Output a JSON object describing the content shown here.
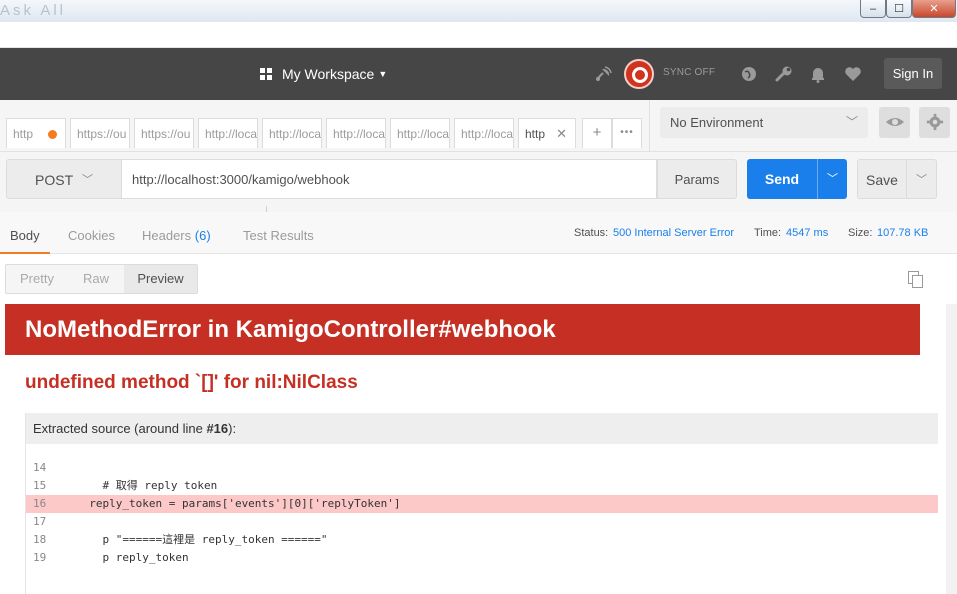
{
  "window": {
    "title_fragment": "Ask All",
    "controls": {
      "minimize": "‒",
      "maximize": "☐",
      "close": "✕"
    }
  },
  "header": {
    "workspace_label": "My Workspace",
    "sync_label": "SYNC OFF",
    "signin_label": "Sign In",
    "icons": [
      "satellite-icon",
      "sync-icon",
      "globe-icon",
      "wrench-icon",
      "bell-icon",
      "heart-icon"
    ]
  },
  "tabs": [
    {
      "label": "http",
      "has_dot": true
    },
    {
      "label": "https://ou"
    },
    {
      "label": "https://ou"
    },
    {
      "label": "http://loca"
    },
    {
      "label": "http://loca"
    },
    {
      "label": "http://loca"
    },
    {
      "label": "http://loca"
    },
    {
      "label": "http://loca"
    },
    {
      "label": "http",
      "active": true,
      "closable": true
    }
  ],
  "tab_actions": {
    "add": "+",
    "more": "•••"
  },
  "environment": {
    "selected": "No Environment"
  },
  "request": {
    "method": "POST",
    "url": "http://localhost:3000/kamigo/webhook",
    "params_label": "Params",
    "send_label": "Send",
    "save_label": "Save"
  },
  "response": {
    "tabs": {
      "body": "Body",
      "cookies": "Cookies",
      "headers": "Headers",
      "headers_count": "(6)",
      "tests": "Test Results"
    },
    "status_label": "Status:",
    "status_value": "500 Internal Server Error",
    "time_label": "Time:",
    "time_value": "4547 ms",
    "size_label": "Size:",
    "size_value": "107.78 KB",
    "views": {
      "pretty": "Pretty",
      "raw": "Raw",
      "preview": "Preview"
    }
  },
  "preview": {
    "error_title": "NoMethodError in KamigoController#webhook",
    "error_message": "undefined method `[]' for nil:NilClass",
    "source_header_prefix": "Extracted source (around line ",
    "source_header_line": "#16",
    "source_header_suffix": "):",
    "source_lines": [
      {
        "num": "14",
        "code": ""
      },
      {
        "num": "15",
        "code": "    # 取得 reply token"
      },
      {
        "num": "16",
        "code": "  reply_token = params['events'][0]['replyToken']",
        "highlight": true
      },
      {
        "num": "17",
        "code": ""
      },
      {
        "num": "18",
        "code": "    p \"======這裡是 reply_token ======\""
      },
      {
        "num": "19",
        "code": "    p reply_token"
      }
    ]
  },
  "colors": {
    "header_bg": "#464646",
    "accent_orange": "#f47b20",
    "send_blue": "#1a7fea",
    "error_red": "#c52f24"
  }
}
